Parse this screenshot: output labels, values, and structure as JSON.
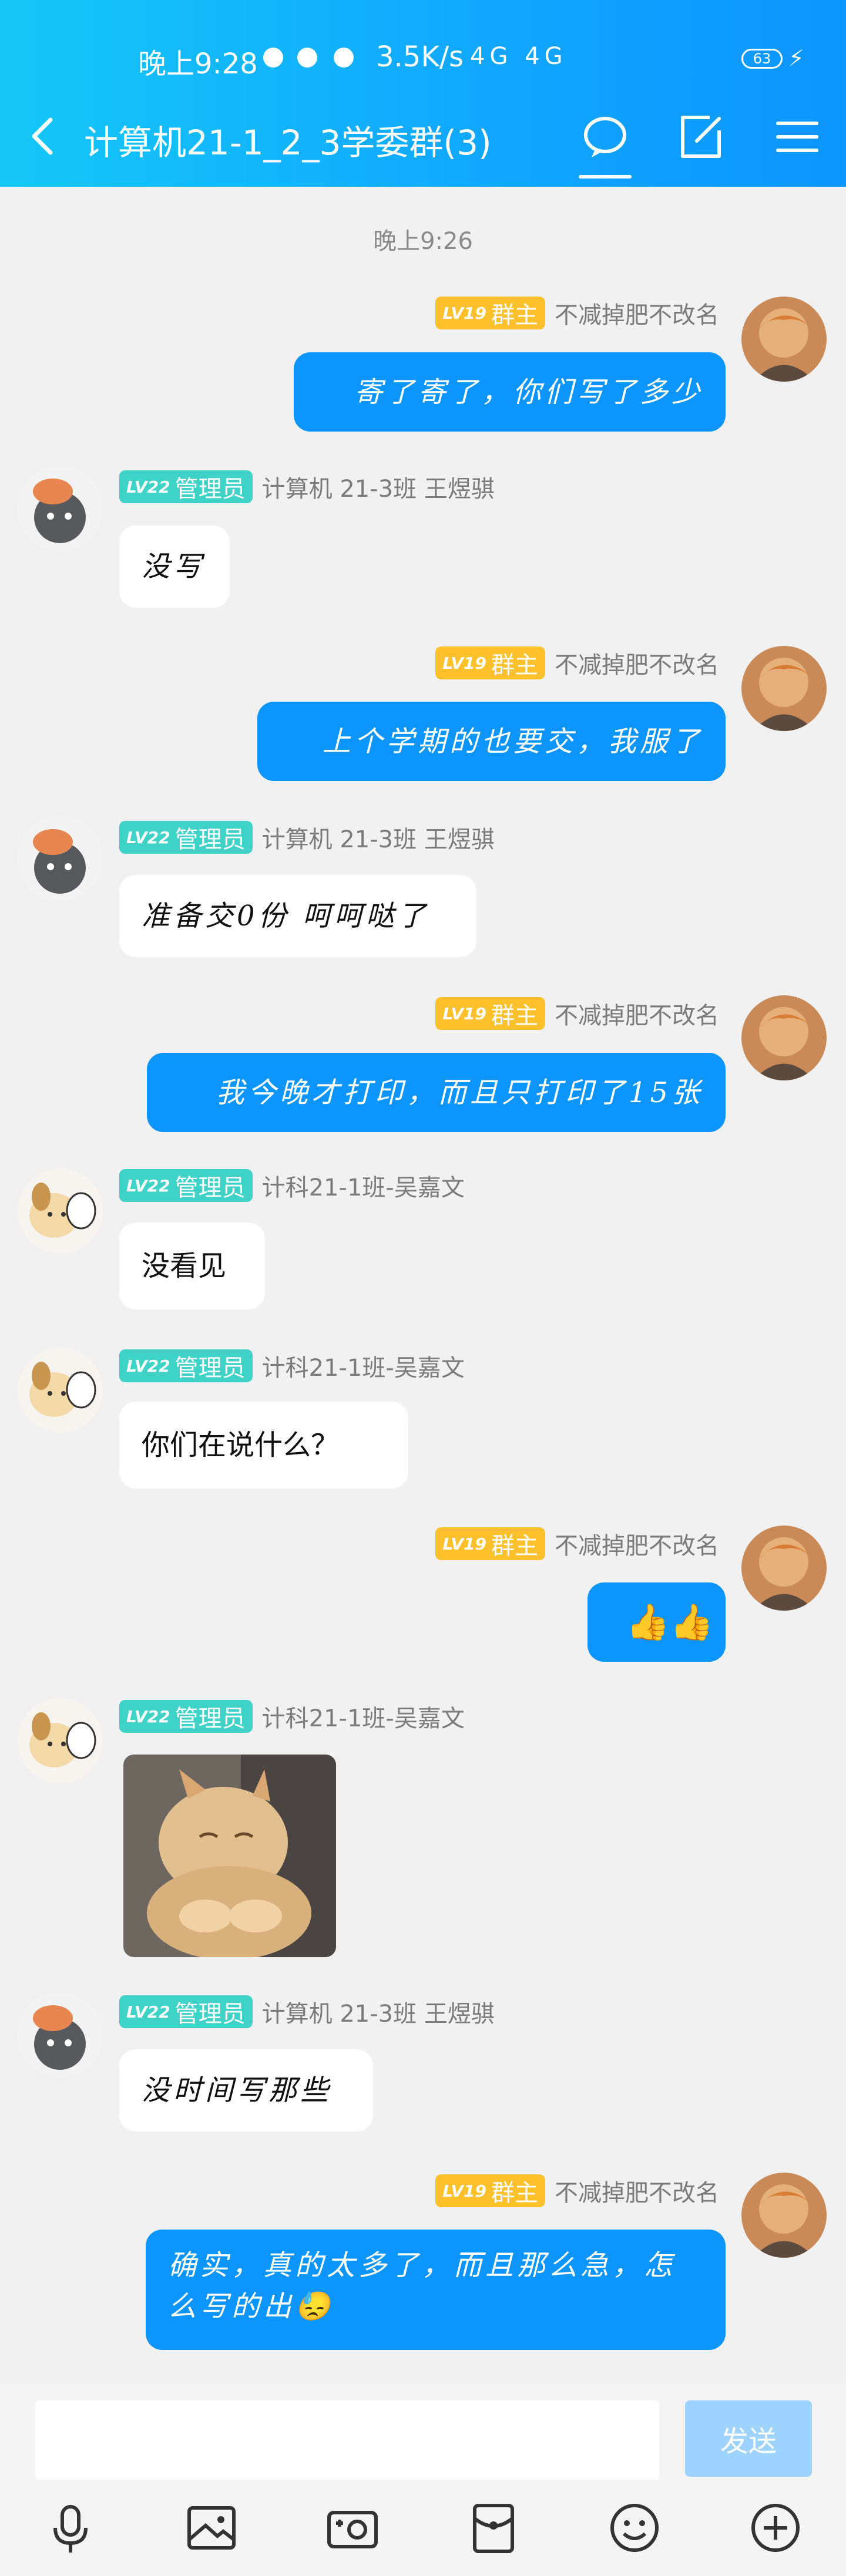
{
  "status_bar": {
    "time": "晚上9:28",
    "speed": "3.5K/s",
    "network": "4G 4G",
    "battery": "63"
  },
  "header": {
    "title": "计算机21-1_2_3学委群(3)"
  },
  "timestamp": "晚上9:26",
  "roles": {
    "owner_level": "LV19",
    "owner_label": "群主",
    "admin_level": "LV22",
    "admin_label": "管理员"
  },
  "users": {
    "owner": "不减掉肥不改名",
    "wang": "计算机 21-3班 王煜骐",
    "wu": "计科21-1班-吴嘉文"
  },
  "messages": [
    {
      "text": "寄了寄了，你们写了多少"
    },
    {
      "text": "没写"
    },
    {
      "text": "上个学期的也要交，我服了"
    },
    {
      "text": "准备交0份  呵呵哒了"
    },
    {
      "text": "我今晚才打印，而且只打印了15张"
    },
    {
      "text": "没看见"
    },
    {
      "text": "你们在说什么？"
    },
    {
      "text": "👍👍"
    },
    {
      "text": "[image]"
    },
    {
      "text": "没时间写那些"
    },
    {
      "text": "确实，真的太多了，而且那么急，怎么写的出😓"
    }
  ],
  "input": {
    "send_label": "发送"
  },
  "icons": {
    "back": "back-arrow-icon",
    "chat": "chat-bubble-icon",
    "edit": "edit-icon",
    "menu": "menu-icon",
    "voice": "microphone-icon",
    "image": "image-icon",
    "camera": "camera-icon",
    "redpacket": "red-packet-icon",
    "emoji": "emoji-icon",
    "plus": "plus-icon"
  },
  "colors": {
    "header": "#11a8ff",
    "outgoing_bubble": "#0d95ff",
    "owner_badge": "#ffc12b",
    "admin_badge": "#3fd3c7",
    "send_button": "#9fd3ff"
  }
}
